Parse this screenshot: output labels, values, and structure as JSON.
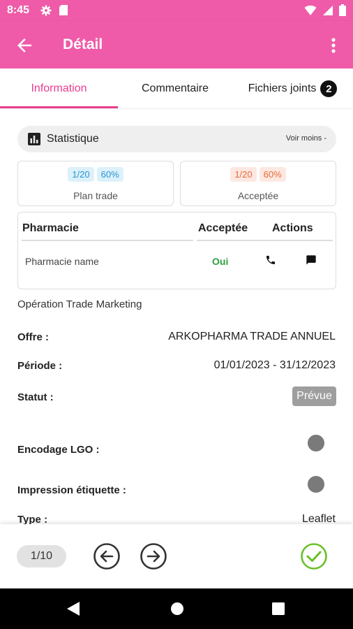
{
  "status_bar": {
    "time": "8:45"
  },
  "app_bar": {
    "title": "Détail"
  },
  "tabs": [
    {
      "label": "Information"
    },
    {
      "label": "Commentaire"
    },
    {
      "label": "Fichiers joints",
      "badge": "2"
    }
  ],
  "statistique": {
    "title": "Statistique",
    "toggle_label": "Voir moins -",
    "cards": [
      {
        "count": "1/20",
        "percent": "60%",
        "label": "Plan trade",
        "color": "#2596d5"
      },
      {
        "count": "1/20",
        "percent": "60%",
        "label": "Acceptée",
        "color": "#e56b3a"
      }
    ],
    "table": {
      "headers": [
        "Pharmacie",
        "Acceptée",
        "Actions"
      ],
      "rows": [
        {
          "pharmacie": "Pharmacie name",
          "acceptee": "Oui"
        }
      ]
    }
  },
  "details": {
    "section_title": "Opération Trade Marketing",
    "offre_label": "Offre :",
    "offre_value": "ARKOPHARMA TRADE ANNUEL",
    "periode_label": "Période :",
    "periode_value": "01/01/2023 - 31/12/2023",
    "statut_label": "Statut :",
    "statut_value": "Prévue",
    "encodage_label": "Encodage LGO :",
    "impression_label": "Impression étiquette :",
    "type_label": "Type :",
    "type_value": "Leaflet"
  },
  "pagination": {
    "page": "1/10"
  },
  "colors": {
    "accent": "#ef5ba8",
    "tab_active": "#e83e8c",
    "confirm": "#6bbf2a",
    "oui": "#2e9e3e"
  }
}
